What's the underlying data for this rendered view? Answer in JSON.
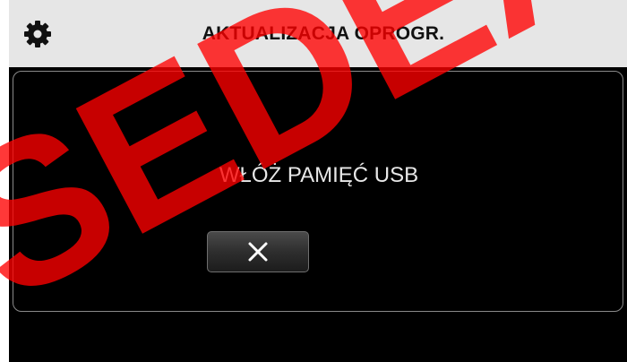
{
  "header": {
    "title": "AKTUALIZACJA OPROGR.",
    "settings_icon": "gear-icon"
  },
  "dialog": {
    "message": "WŁÓŻ PAMIĘĆ USB",
    "close_button": {
      "icon": "close-icon"
    }
  },
  "watermark": {
    "text": "SEDEA",
    "color": "#ff0000"
  },
  "colors": {
    "background": "#000000",
    "header_bg": "#e6e6e6",
    "text_light": "#e8e8e8"
  }
}
